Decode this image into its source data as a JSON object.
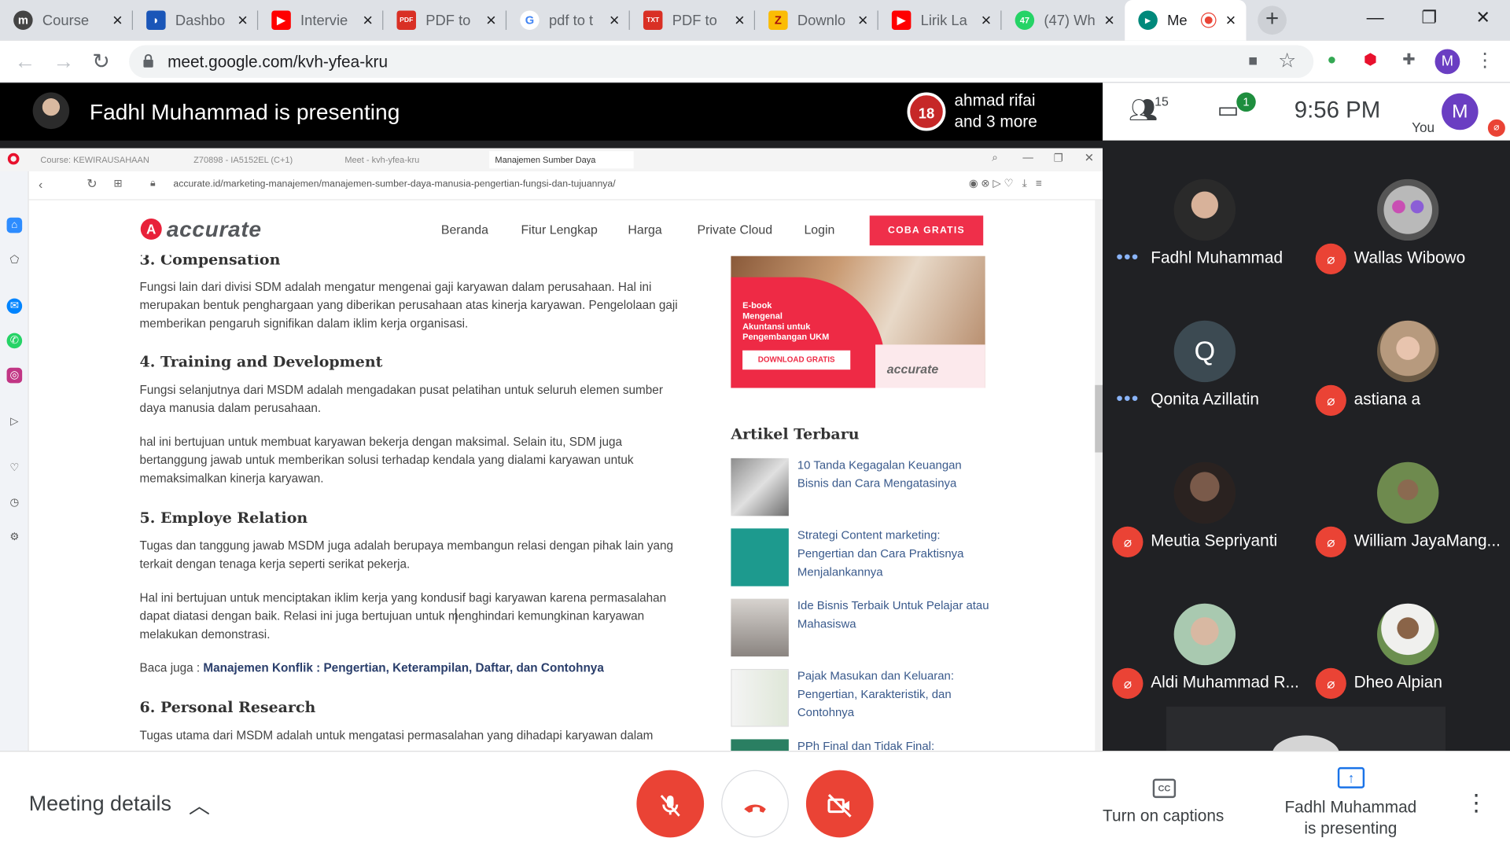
{
  "browser": {
    "tabs": [
      {
        "label": "Course",
        "favicon": "m"
      },
      {
        "label": "Dashbo",
        "favicon": "bank"
      },
      {
        "label": "Intervie",
        "favicon": "youtube"
      },
      {
        "label": "PDF to",
        "favicon": "pdf"
      },
      {
        "label": "pdf to t",
        "favicon": "G"
      },
      {
        "label": "PDF to",
        "favicon": "txt"
      },
      {
        "label": "Downlo",
        "favicon": "Z"
      },
      {
        "label": "Lirik La",
        "favicon": "youtube"
      },
      {
        "label": "(47) Wh",
        "favicon": "47"
      },
      {
        "label": "Me",
        "favicon": "meet"
      }
    ],
    "url": "meet.google.com/kvh-yfea-kru",
    "profile_initial": "M"
  },
  "meet": {
    "presenting_title": "Fadhl Muhammad is presenting",
    "raised_hand": {
      "badge": "18",
      "line1": "ahmad rifai",
      "line2": "and 3 more"
    },
    "participant_count": "15",
    "chat_badge": "1",
    "time": "9:56 PM",
    "self": {
      "initial": "M",
      "label": "You"
    },
    "participants": [
      {
        "name": "Fadhl Muhammad",
        "status": "speaking"
      },
      {
        "name": "Wallas Wibowo",
        "status": "muted"
      },
      {
        "name": "Qonita Azillatin",
        "status": "speaking",
        "initial": "Q"
      },
      {
        "name": "astiana a",
        "status": "muted"
      },
      {
        "name": "Meutia Sepriyanti",
        "status": "muted"
      },
      {
        "name": "William JayaMang...",
        "status": "muted"
      },
      {
        "name": "Aldi Muhammad R...",
        "status": "muted"
      },
      {
        "name": "Dheo Alpian",
        "status": "muted"
      }
    ],
    "bottom": {
      "meeting_details": "Meeting details",
      "captions": "Turn on captions",
      "presenting_line1": "Fadhl Muhammad",
      "presenting_line2": "is presenting"
    }
  },
  "shared": {
    "tabs": [
      "Course: KEWIRAUSAHAAN",
      "Z70898 - IA5152EL (C+1)",
      "Meet - kvh-yfea-kru",
      "Manajemen Sumber Daya"
    ],
    "url": "accurate.id/marketing-manajemen/manajemen-sumber-daya-manusia-pengertian-fungsi-dan-tujuannya/",
    "logo": "accurate",
    "nav": [
      "Beranda",
      "Fitur Lengkap",
      "Harga",
      "Private Cloud",
      "Login"
    ],
    "cta": "COBA GRATIS",
    "h_compensation": "3. Compensation",
    "p_compensation": "Fungsi lain dari divisi SDM adalah mengatur mengenai gaji karyawan dalam perusahaan. Hal ini merupakan bentuk penghargaan yang diberikan perusahaan atas kinerja karyawan. Pengelolaan gaji memberikan pengaruh signifikan dalam iklim kerja organisasi.",
    "h_training": "4. Training and Development",
    "p_training1": "Fungsi selanjutnya dari MSDM adalah mengadakan pusat pelatihan untuk seluruh elemen sumber daya manusia dalam perusahaan.",
    "p_training2": "hal ini bertujuan untuk membuat karyawan bekerja dengan maksimal. Selain itu, SDM juga bertanggung jawab untuk memberikan solusi terhadap kendala yang dialami karyawan untuk memaksimalkan kinerja karyawan.",
    "h_relation": "5. Employe Relation",
    "p_relation1": "Tugas dan tanggung jawab MSDM juga adalah berupaya membangun relasi dengan pihak lain yang terkait dengan tenaga kerja seperti serikat pekerja.",
    "p_relation2": "Hal ini bertujuan untuk menciptakan iklim kerja yang kondusif bagi karyawan karena permasalahan dapat diatasi dengan baik. Relasi ini juga bertujuan untuk menghindari kemungkinan karyawan melakukan demonstrasi.",
    "baca_prefix": "Baca juga : ",
    "baca_link": "Manajemen Konflik : Pengertian, Keterampilan, Daftar, dan Contohnya",
    "h_research": "6. Personal Research",
    "p_research": "Tugas utama dari MSDM adalah untuk mengatasi permasalahan yang dihadapi karyawan dalam",
    "banner": {
      "text": "E-book\nMengenal\nAkuntansi untuk\nPengembangan UKM",
      "button": "DOWNLOAD GRATIS",
      "logo": "accurate"
    },
    "related_title": "Artikel Terbaru",
    "related": [
      "10 Tanda Kegagalan Keuangan Bisnis dan Cara Mengatasinya",
      "Strategi Content marketing: Pengertian dan Cara Praktisnya Menjalankannya",
      "Ide Bisnis Terbaik Untuk Pelajar atau Mahasiswa",
      "Pajak Masukan dan Keluaran: Pengertian, Karakteristik, dan Contohnya",
      "PPh Final dan Tidak Final:"
    ]
  },
  "colors": {
    "meet_red": "#ea4335",
    "meet_blue": "#1a73e8",
    "accurate_red": "#ef2f4a",
    "link_blue": "#3a5a8c"
  }
}
